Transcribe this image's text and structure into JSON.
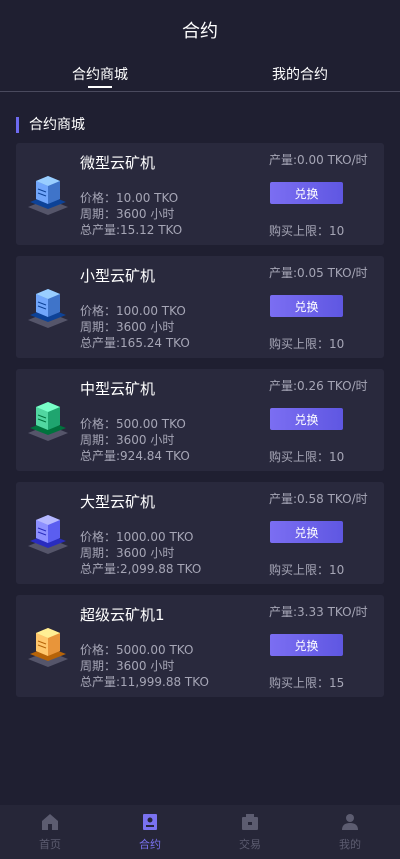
{
  "header": {
    "title": "合约"
  },
  "tabs": [
    {
      "label": "合约商城",
      "active": true
    },
    {
      "label": "我的合约",
      "active": false
    }
  ],
  "section": {
    "title": "合约商城"
  },
  "products": [
    {
      "name": "微型云矿机",
      "price": "价格：10.00 TKO",
      "cycle": "周期：3600 小时",
      "total": "总产量:15.12 TKO",
      "output": "产量:0.00 TKO/时",
      "button": "兑换",
      "limit": "购买上限：10",
      "color": "#3f74c9"
    },
    {
      "name": "小型云矿机",
      "price": "价格：100.00 TKO",
      "cycle": "周期：3600 小时",
      "total": "总产量:165.24 TKO",
      "output": "产量:0.05 TKO/时",
      "button": "兑换",
      "limit": "购买上限：10",
      "color": "#3f74c9"
    },
    {
      "name": "中型云矿机",
      "price": "价格：500.00 TKO",
      "cycle": "周期：3600 小时",
      "total": "总产量:924.84 TKO",
      "output": "产量:0.26 TKO/时",
      "button": "兑换",
      "limit": "购买上限：10",
      "color": "#1fa56f"
    },
    {
      "name": "大型云矿机",
      "price": "价格：1000.00 TKO",
      "cycle": "周期：3600 小时",
      "total": "总产量:2,099.88 TKO",
      "output": "产量:0.58 TKO/时",
      "button": "兑换",
      "limit": "购买上限：10",
      "color": "#5b5ef0"
    },
    {
      "name": "超级云矿机1",
      "price": "价格：5000.00 TKO",
      "cycle": "周期：3600 小时",
      "total": "总产量:11,999.88 TKO",
      "output": "产量:3.33 TKO/时",
      "button": "兑换",
      "limit": "购买上限：15",
      "color": "#e8953a"
    }
  ],
  "tabbar": [
    {
      "label": "首页",
      "icon": "home-icon",
      "active": false
    },
    {
      "label": "合约",
      "icon": "contract-icon",
      "active": true
    },
    {
      "label": "交易",
      "icon": "trade-icon",
      "active": false
    },
    {
      "label": "我的",
      "icon": "user-icon",
      "active": false
    }
  ]
}
